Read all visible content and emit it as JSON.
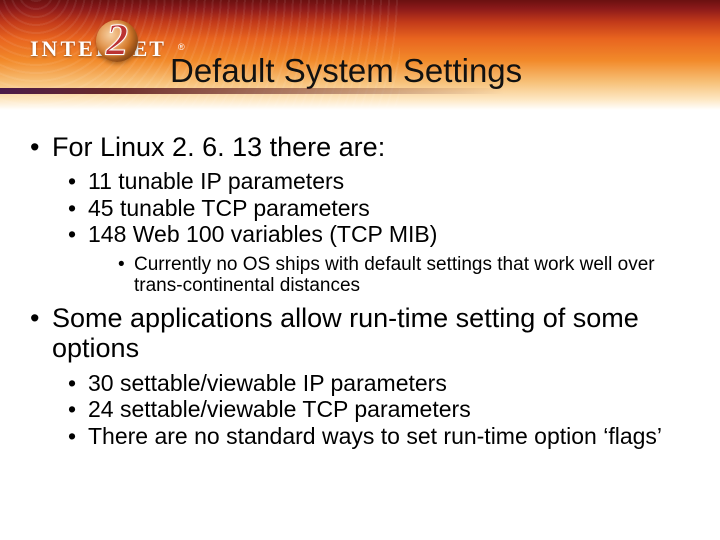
{
  "header": {
    "logo_main": "INTER",
    "logo_suffix": "NET",
    "logo_numeral": "2",
    "logo_reg": "®"
  },
  "title": "Default System Settings",
  "bullets": [
    {
      "text": "For Linux 2. 6. 13 there are:",
      "children": [
        {
          "text": "11 tunable IP parameters"
        },
        {
          "text": "45 tunable TCP parameters"
        },
        {
          "text": "148 Web 100 variables (TCP MIB)",
          "children": [
            {
              "text": "Currently no OS ships with default settings that work well over trans-continental distances"
            }
          ]
        }
      ]
    },
    {
      "text": "Some applications allow run-time setting of some options",
      "children": [
        {
          "text": "30 settable/viewable IP parameters"
        },
        {
          "text": "24 settable/viewable TCP parameters"
        },
        {
          "text": "There are no standard ways to set run-time option ‘flags’"
        }
      ]
    }
  ]
}
